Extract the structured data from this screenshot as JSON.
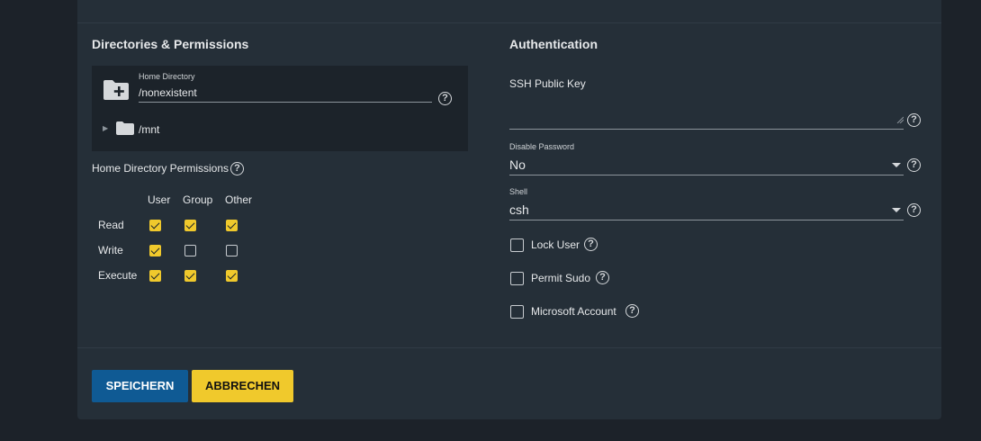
{
  "left": {
    "title": "Directories & Permissions",
    "home_dir_label": "Home Directory",
    "home_dir_value": "/nonexistent",
    "tree_item": "/mnt",
    "perm_label": "Home Directory Permissions",
    "columns": [
      "User",
      "Group",
      "Other"
    ],
    "rows": [
      {
        "label": "Read",
        "values": [
          true,
          true,
          true
        ]
      },
      {
        "label": "Write",
        "values": [
          true,
          false,
          false
        ]
      },
      {
        "label": "Execute",
        "values": [
          true,
          true,
          true
        ]
      }
    ]
  },
  "right": {
    "title": "Authentication",
    "ssh_label": "SSH Public Key",
    "disable_pw_label": "Disable Password",
    "disable_pw_value": "No",
    "shell_label": "Shell",
    "shell_value": "csh",
    "checkboxes": [
      {
        "label": "Lock User",
        "checked": false
      },
      {
        "label": "Permit Sudo",
        "checked": false
      },
      {
        "label": "Microsoft Account",
        "checked": false
      }
    ]
  },
  "buttons": {
    "save": "SPEICHERN",
    "cancel": "ABBRECHEN"
  },
  "icons": {
    "help": "?",
    "folder-plus": "folder-plus-icon",
    "folder": "folder-icon"
  },
  "colors": {
    "accent": "#f0c92c",
    "primary": "#0f5a94"
  }
}
